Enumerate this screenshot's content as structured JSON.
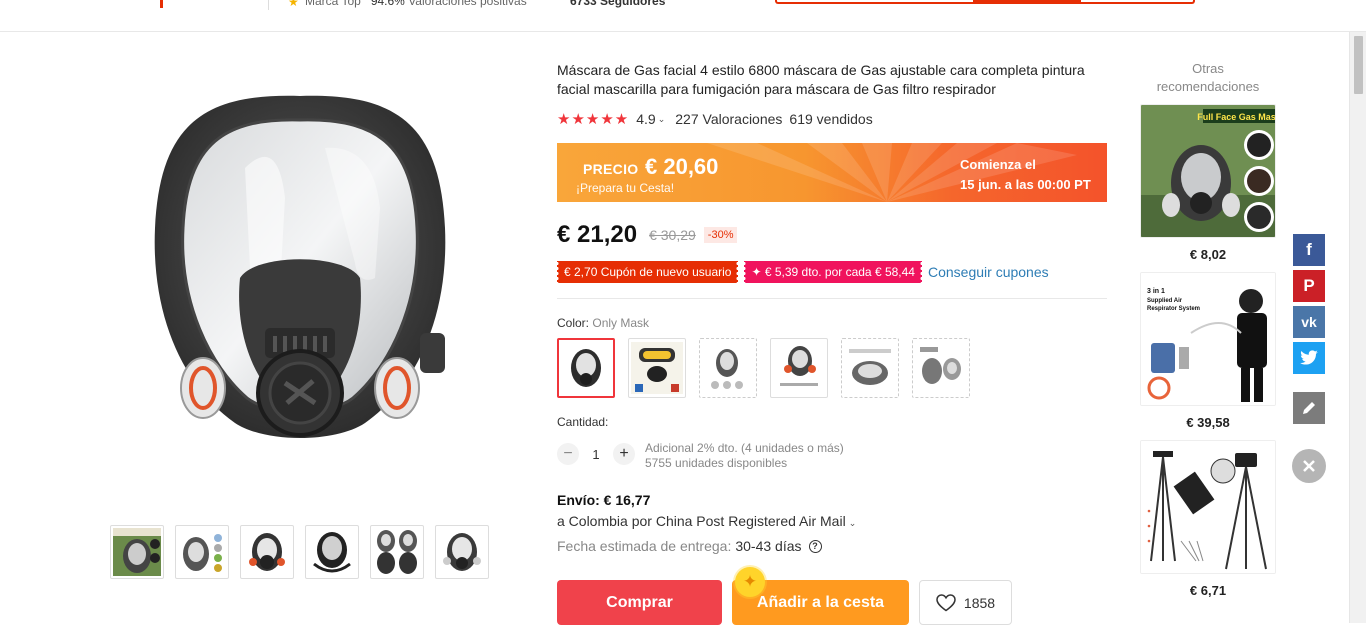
{
  "store_bar": {
    "badge": "Marca Top",
    "positive_pct": "94.6%",
    "positive_label": "Valoraciones positivas",
    "followers": "6733 Seguidores"
  },
  "product": {
    "title": "Máscara de Gas facial 4 estilo 6800 máscara de Gas ajustable cara completa pintura facial mascarilla para fumigación para máscara de Gas filtro respirador",
    "rating": 4.9,
    "rating_text": "4.9",
    "reviews": "227 Valoraciones",
    "sold": "619 vendidos"
  },
  "promo": {
    "label": "PRECIO",
    "price": "€ 20,60",
    "subtitle": "¡Prepara tu Cesta!",
    "starts_line1": "Comienza el",
    "starts_line2": "15 jun. a las 00:00 PT"
  },
  "pricing": {
    "current": "€ 21,20",
    "original": "€ 30,29",
    "discount": "-30%"
  },
  "coupons": {
    "new_user": "€ 2,70 Cupón de nuevo usuario",
    "store": "✦ € 5,39 dto. por cada € 58,44",
    "get_link": "Conseguir cupones"
  },
  "color": {
    "label": "Color:",
    "selected": "Only Mask"
  },
  "quantity": {
    "label": "Cantidad:",
    "value": "1",
    "extra_discount": "Adicional 2% dto. (4 unidades o más)",
    "available": "5755 unidades disponibles"
  },
  "shipping": {
    "cost": "Envío: € 16,77",
    "destination": "a Colombia por China Post Registered Air Mail",
    "eta_label": "Fecha estimada de entrega:",
    "eta_value": "30-43 días"
  },
  "actions": {
    "buy": "Comprar",
    "add_to_cart": "Añadir a la cesta",
    "wishlist_count": "1858"
  },
  "recommendations": {
    "header": "Otras recomendaciones",
    "items": [
      {
        "price": "€ 8,02",
        "img_text": "Full Face Gas Mask"
      },
      {
        "price": "€ 39,58",
        "img_text": "3 in 1 Supplied Air Respirator System"
      },
      {
        "price": "€ 6,71",
        "img_text": ""
      }
    ]
  },
  "share": [
    "facebook",
    "pinterest",
    "vk",
    "twitter"
  ],
  "colors": {
    "accent_red": "#f0353b",
    "cart_orange": "#ff9a1f",
    "facebook": "#3b5998",
    "pinterest": "#cb2027",
    "vk": "#4a76a8",
    "twitter": "#1da1f2"
  }
}
